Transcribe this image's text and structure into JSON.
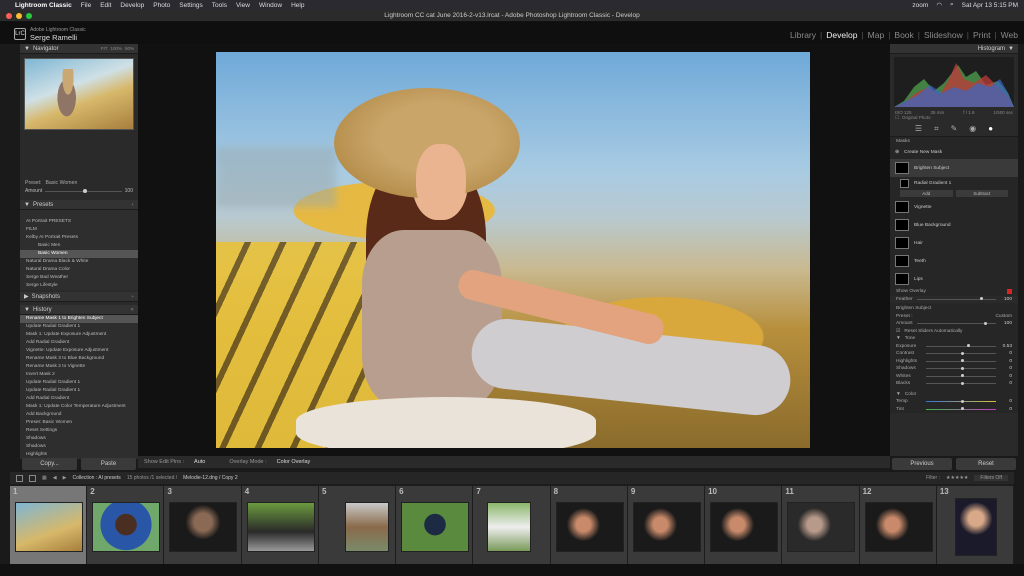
{
  "mac": {
    "app": "Lightroom Classic",
    "menus": [
      "File",
      "Edit",
      "Develop",
      "Photo",
      "Settings",
      "Tools",
      "View",
      "Window",
      "Help"
    ],
    "zoom": "zoom",
    "datetime": "Sat Apr 13  5:15 PM"
  },
  "window": {
    "title": "Lightroom CC cat June 2016-2-v13.lrcat - Adobe Photoshop Lightroom Classic - Develop"
  },
  "identity": {
    "badge": "LrC",
    "app": "Adobe Lightroom Classic",
    "user": "Serge Ramelli"
  },
  "modules": [
    "Library",
    "Develop",
    "Map",
    "Book",
    "Slideshow",
    "Print",
    "Web"
  ],
  "active_module": "Develop",
  "navigator": {
    "title": "Navigator",
    "zoom": [
      "FIT",
      "100%",
      "50%"
    ]
  },
  "preset": {
    "label": "Preset:",
    "name": "Basic Women",
    "amount_label": "Amount",
    "amount": "100"
  },
  "presets": {
    "title": "Presets",
    "items": [
      "AI Portrait PRESETS",
      "FILM",
      "Kelby AI Portrait Presets",
      "Basic Men",
      "Basic Women",
      "Natural Drama Black & White",
      "Natural Drama Color",
      "Serge Bad Weather",
      "Serge Lifestyle"
    ]
  },
  "snapshots": {
    "title": "Snapshots"
  },
  "history": {
    "title": "History",
    "items": [
      "Rename Mask 1 to Brighten Subject",
      "Update Radial Gradient 1",
      "Mask 1: Update Exposure Adjustment",
      "Add Radial Gradient",
      "Vignette: Update Exposure Adjustment",
      "Rename Mask 3 to Blue Background",
      "Rename Mask 2 to Vignette",
      "Invert Mask 2",
      "Update Radial Gradient 1",
      "Update Radial Gradient 1",
      "Add Radial Gradient",
      "Mask 1: Update Color Temperature Adjustment",
      "Add Background",
      "Preset: Basic Women",
      "Reset Settings",
      "Shadows",
      "Shadows",
      "Highlights"
    ]
  },
  "left_buttons": {
    "copy": "Copy...",
    "paste": "Paste"
  },
  "canvas_bar": {
    "show_edit_pins": "Show Edit Pins :",
    "edit_pins_val": "Auto",
    "overlay_mode": "Overlay Mode :",
    "overlay_val": "Color Overlay"
  },
  "histogram": {
    "title": "Histogram",
    "labels": [
      "ISO 125",
      "35 mm",
      "f / 1.8",
      "1/500 sec"
    ],
    "original": "Original Photo"
  },
  "masks": {
    "title": "Masks",
    "create": "Create New Mask",
    "rows": [
      "Brighten Subject",
      "Radial Gradient 1",
      "Vignette",
      "Blue Background",
      "Hair",
      "Teeth",
      "Lips"
    ],
    "add": "Add",
    "subtract": "Subtract",
    "show_overlay": "Show Overlay"
  },
  "feather": {
    "label": "Feather",
    "value": "100"
  },
  "adjust": {
    "mask_name": "Brighten Subject",
    "preset_label": "Preset :",
    "preset_val": "Custom",
    "amount_label": "Amount",
    "amount_val": "100",
    "reset_sliders": "Reset Sliders Automatically",
    "tone_title": "Tone",
    "tone": [
      {
        "name": "Exposure",
        "val": "0.53"
      },
      {
        "name": "Contrast",
        "val": "0"
      },
      {
        "name": "Highlights",
        "val": "0"
      },
      {
        "name": "Shadows",
        "val": "0"
      },
      {
        "name": "Whites",
        "val": "0"
      },
      {
        "name": "Blacks",
        "val": "0"
      }
    ],
    "color_title": "Color",
    "color": [
      {
        "name": "Temp",
        "val": "0"
      },
      {
        "name": "Tint",
        "val": "0"
      }
    ]
  },
  "right_buttons": {
    "previous": "Previous",
    "reset": "Reset"
  },
  "filmstrip_bar": {
    "collection": "Collection : AI presets",
    "count": "15 photos /1 selected /",
    "file": "Melodie-12.dng / Copy 2",
    "filter": "Filter :",
    "filters_off": "Filters Off"
  },
  "filmstrip": [
    "1",
    "2",
    "3",
    "4",
    "5",
    "6",
    "7",
    "8",
    "9",
    "10",
    "11",
    "12",
    "13"
  ],
  "colors": {
    "accent": "#e2e2e2",
    "panel": "#2a2a2a",
    "background": "#111111"
  }
}
